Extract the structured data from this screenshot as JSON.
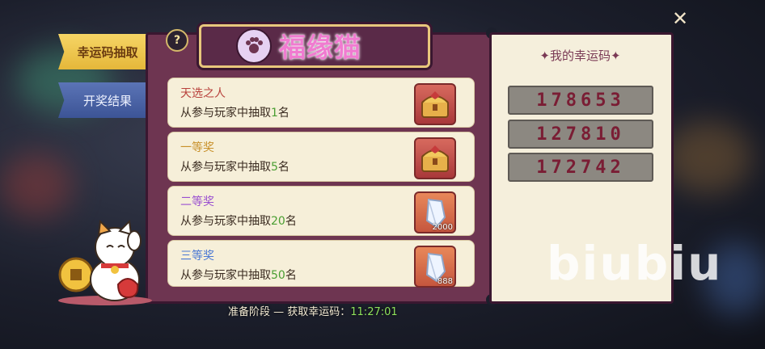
{
  "tabs": [
    {
      "label": "幸运码抽取",
      "active": true
    },
    {
      "label": "开奖结果",
      "active": false
    }
  ],
  "help": {
    "label": "?"
  },
  "title": "福缘猫",
  "prizes": [
    {
      "name": "天选之人",
      "name_color": "#b8413c",
      "desc_prefix": "从参与玩家中抽取",
      "count": "1",
      "desc_suffix": "名",
      "reward_icon": "treasure-chest-icon",
      "qty": ""
    },
    {
      "name": "一等奖",
      "name_color": "#c8902a",
      "desc_prefix": "从参与玩家中抽取",
      "count": "5",
      "desc_suffix": "名",
      "reward_icon": "treasure-chest-icon",
      "qty": ""
    },
    {
      "name": "二等奖",
      "name_color": "#9a4fd0",
      "desc_prefix": "从参与玩家中抽取",
      "count": "20",
      "desc_suffix": "名",
      "reward_icon": "crystal-icon",
      "qty": "2000"
    },
    {
      "name": "三等奖",
      "name_color": "#4a78d4",
      "desc_prefix": "从参与玩家中抽取",
      "count": "50",
      "desc_suffix": "名",
      "reward_icon": "crystal-icon",
      "qty": "888"
    }
  ],
  "lucky": {
    "title": "✦我的幸运码✦",
    "codes": [
      "178653",
      "127810",
      "172742"
    ]
  },
  "status": {
    "label": "准备阶段 — 获取幸运码：",
    "timer": "11:27:01"
  },
  "watermark": "biubiu",
  "close": "✕"
}
